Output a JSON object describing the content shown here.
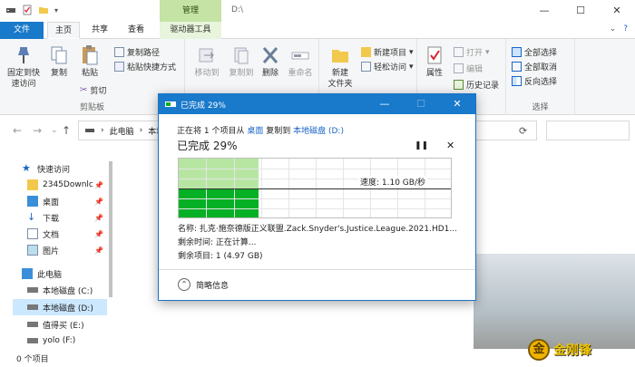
{
  "window": {
    "title": "D:\\",
    "contextual_tab_header": "管理",
    "controls": [
      "—",
      "☐",
      "✕"
    ]
  },
  "ribbon_tabs": {
    "file": "文件",
    "home": "主页",
    "share": "共享",
    "view": "查看",
    "drive_tools": "驱动器工具"
  },
  "ribbon": {
    "clipboard": {
      "pin": "固定到快\n速访问",
      "copy": "复制",
      "paste": "粘贴",
      "copy_path": "复制路径",
      "paste_shortcut": "粘贴快捷方式",
      "cut": "剪切",
      "label": "剪贴板"
    },
    "organize": {
      "move_to": "移动到",
      "copy_to": "复制到",
      "delete": "删除",
      "rename": "重命名"
    },
    "new": {
      "new_folder": "新建\n文件夹",
      "new_item": "新建项目",
      "easy_access": "轻松访问"
    },
    "open": {
      "properties": "属性",
      "open": "打开",
      "edit": "编辑",
      "history": "历史记录"
    },
    "select": {
      "select_all": "全部选择",
      "select_none": "全部取消",
      "invert": "反向选择",
      "label": "选择"
    }
  },
  "address": {
    "segments": [
      "此电脑",
      "本地磁盘 (D:)"
    ]
  },
  "nav_pane": {
    "items": [
      {
        "label": "快速访问",
        "icon": "star-icon"
      },
      {
        "label": "2345Downlc",
        "icon": "folder-icon",
        "pinned": true
      },
      {
        "label": "桌面",
        "icon": "desktop-icon",
        "pinned": true
      },
      {
        "label": "下载",
        "icon": "download-icon",
        "pinned": true
      },
      {
        "label": "文档",
        "icon": "document-icon",
        "pinned": true
      },
      {
        "label": "图片",
        "icon": "picture-icon",
        "pinned": true
      },
      {
        "label": "此电脑",
        "icon": "computer-icon"
      },
      {
        "label": "本地磁盘 (C:)",
        "icon": "drive-icon"
      },
      {
        "label": "本地磁盘 (D:)",
        "icon": "drive-icon",
        "selected": true
      },
      {
        "label": "值得买 (E:)",
        "icon": "drive-icon"
      },
      {
        "label": "yolo (F:)",
        "icon": "drive-icon"
      }
    ]
  },
  "status_bar": {
    "count": "0 个项目"
  },
  "watermark": {
    "mark": "金",
    "text": "金刚锋"
  },
  "copy_dialog": {
    "title": "已完成 29%",
    "line_prefix": "正在将 1 个项目从",
    "source": "桌面",
    "line_mid": "复制到",
    "dest": "本地磁盘 (D:)",
    "percent_text": "已完成 29%",
    "progress": 0.29,
    "speed": "速度: 1.10 GB/秒",
    "name": "名称: 扎克·施奈德版正义联盟.Zack.Snyder's.Justice.League.2021.HD1...",
    "time_remaining": "剩余时间: 正在计算...",
    "items_remaining": "剩余项目: 1 (4.97 GB)",
    "less_info": "简略信息",
    "colors": {
      "bar": "#06b025",
      "bar_light": "#b6e6a2",
      "titlebar": "#1979ca"
    }
  }
}
